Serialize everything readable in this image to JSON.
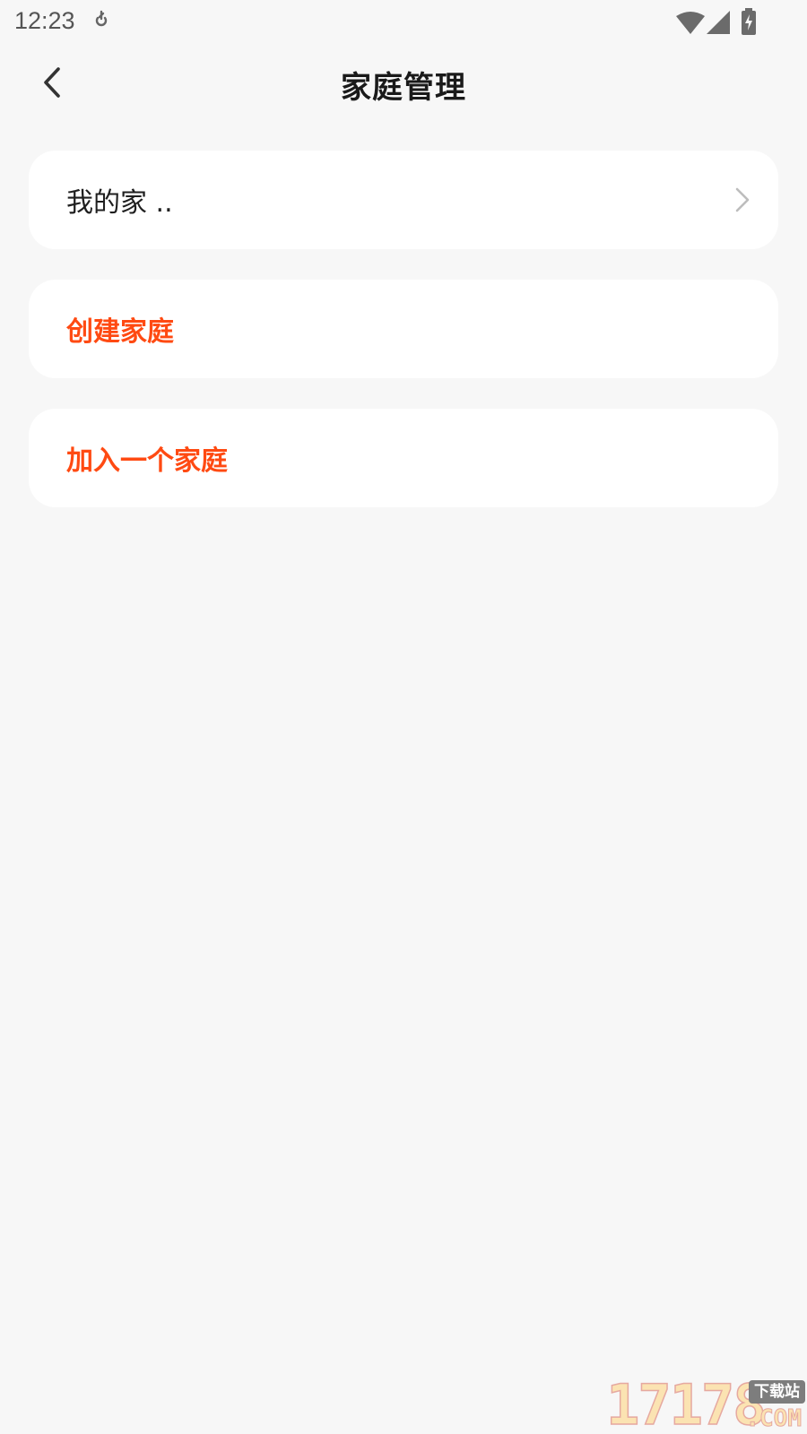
{
  "status_bar": {
    "time": "12:23",
    "icons": [
      "notification-icon",
      "wifi-icon",
      "signal-icon",
      "battery-charging-icon"
    ]
  },
  "header": {
    "title": "家庭管理",
    "back_icon": "chevron-left-icon"
  },
  "families": [
    {
      "label": "我的家 ..",
      "icon": "chevron-right-icon"
    }
  ],
  "actions": {
    "create_label": "创建家庭",
    "join_label": "加入一个家庭"
  },
  "colors": {
    "background": "#f7f7f7",
    "card": "#ffffff",
    "accent": "#ff4a12",
    "text": "#1f1f1f"
  },
  "watermark": {
    "digits": "17178",
    "tag": "下载站",
    "domain": ".COM"
  }
}
